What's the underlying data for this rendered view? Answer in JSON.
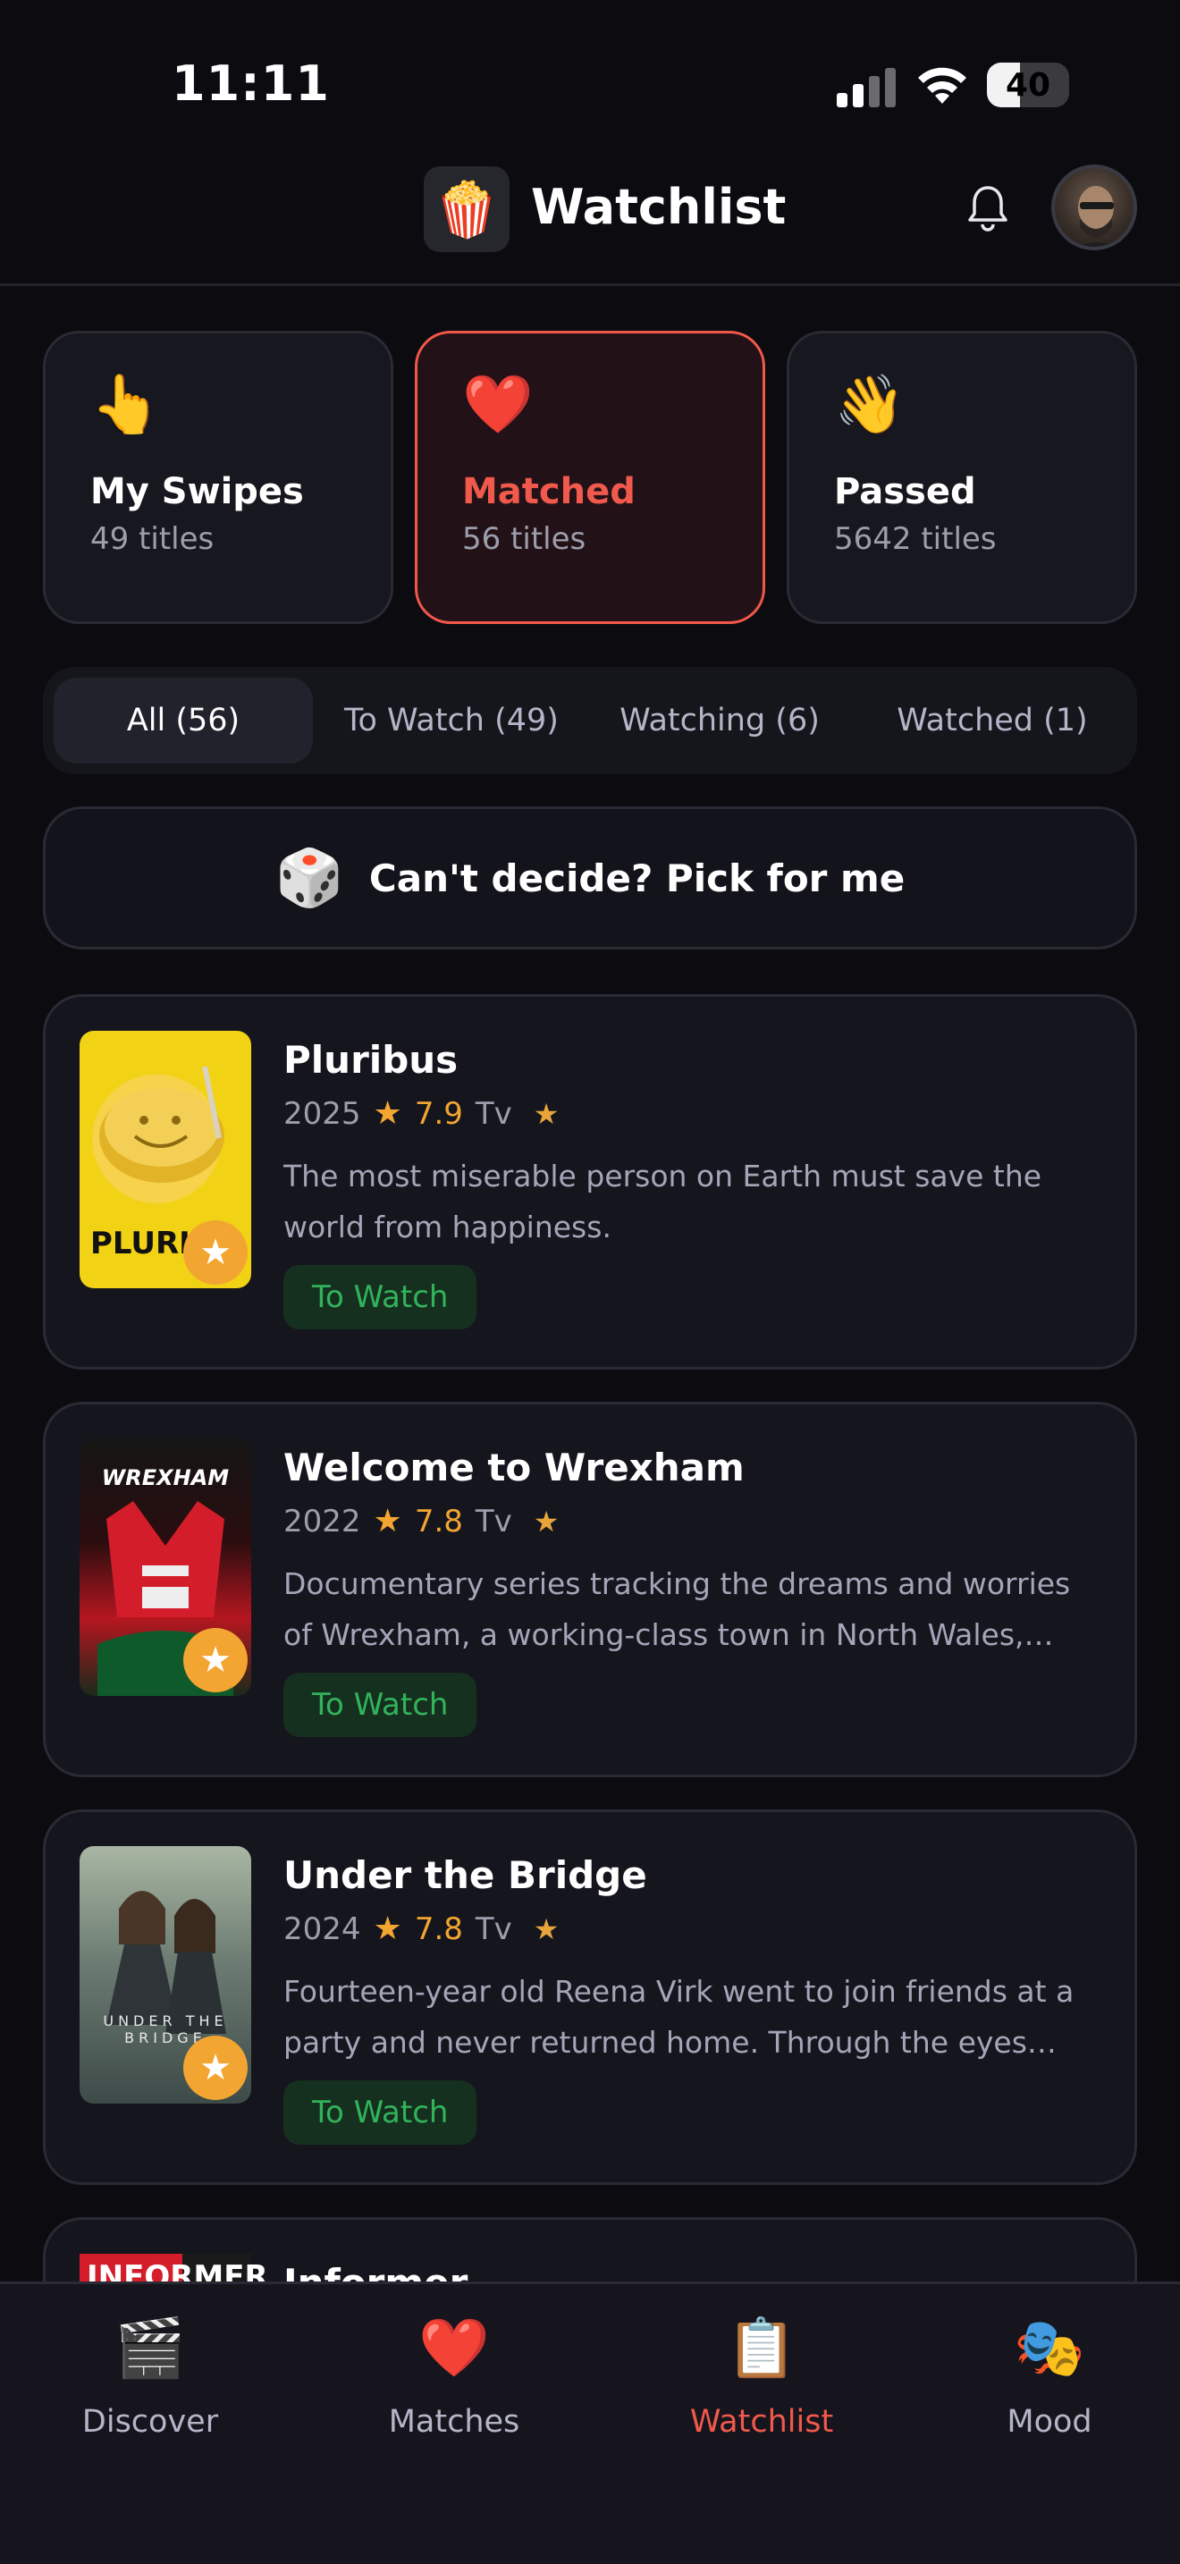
{
  "status_bar": {
    "time": "11:11",
    "battery": "40",
    "battery_level_percent": 40,
    "icons": [
      "cellular-signal-icon",
      "wifi-icon",
      "battery-icon"
    ]
  },
  "header": {
    "logo_icon": "🍿",
    "title": "Watchlist",
    "bell_icon": "bell-icon",
    "avatar_icon": "user-avatar"
  },
  "summary": [
    {
      "emoji": "👆",
      "title": "My Swipes",
      "subtitle": "49 titles"
    },
    {
      "emoji": "❤️",
      "title": "Matched",
      "subtitle": "56 titles",
      "active": true
    },
    {
      "emoji": "👋",
      "title": "Passed",
      "subtitle": "5642 titles"
    }
  ],
  "tabs": [
    {
      "label": "All (56)",
      "active": true
    },
    {
      "label": "To Watch (49)"
    },
    {
      "label": "Watching (6)"
    },
    {
      "label": "Watched (1)"
    }
  ],
  "pick": {
    "icon": "🎲",
    "label": "Can't decide? Pick for me"
  },
  "items": [
    {
      "title": "Pluribus",
      "year": "2025",
      "rating": "7.9",
      "type": "Tv",
      "description": "The most miserable person on Earth must save the world from happiness.",
      "status": "To Watch",
      "poster_text": "PLURI"
    },
    {
      "title": "Welcome to Wrexham",
      "year": "2022",
      "rating": "7.8",
      "type": "Tv",
      "description": "Documentary series tracking the dreams and worries of Wrexham, a working-class town in North Wales, UK,...",
      "status": "To Watch",
      "poster_text": "WREXHAM"
    },
    {
      "title": "Under the Bridge",
      "year": "2024",
      "rating": "7.8",
      "type": "Tv",
      "description": "Fourteen-year old Reena Virk went to join friends at a party and never returned home. Through the eyes of...",
      "status": "To Watch",
      "poster_text": "UNDER THE BRIDGE"
    }
  ],
  "partial_item": {
    "title": "Informer",
    "poster_text": "INFORMER"
  },
  "colors": {
    "accent": "#f0594b",
    "rating": "#f3a531",
    "status_bg": "#16301f",
    "status_text": "#31b35c"
  },
  "nav": [
    {
      "icon": "🎬",
      "label": "Discover"
    },
    {
      "icon": "❤️",
      "label": "Matches"
    },
    {
      "icon": "📋",
      "label": "Watchlist",
      "active": true
    },
    {
      "icon": "🎭",
      "label": "Mood"
    }
  ]
}
